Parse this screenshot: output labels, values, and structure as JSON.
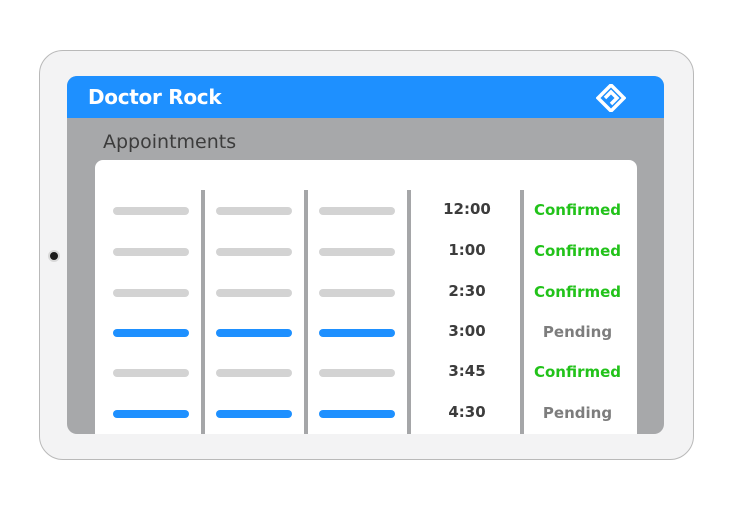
{
  "app": {
    "title": "Doctor Rock",
    "brand_color": "#1e90ff"
  },
  "section": {
    "title": "Appointments"
  },
  "appointments": [
    {
      "time": "12:00",
      "status": "Confirmed",
      "highlighted": false
    },
    {
      "time": "1:00",
      "status": "Confirmed",
      "highlighted": false
    },
    {
      "time": "2:30",
      "status": "Confirmed",
      "highlighted": false
    },
    {
      "time": "3:00",
      "status": "Pending",
      "highlighted": true
    },
    {
      "time": "3:45",
      "status": "Confirmed",
      "highlighted": false
    },
    {
      "time": "4:30",
      "status": "Pending",
      "highlighted": true
    }
  ],
  "status_colors": {
    "Confirmed": "#22c21a",
    "Pending": "#7d7d7d"
  },
  "icons": {
    "logo": "diamond-logo-icon",
    "camera": "camera-dot-icon"
  }
}
